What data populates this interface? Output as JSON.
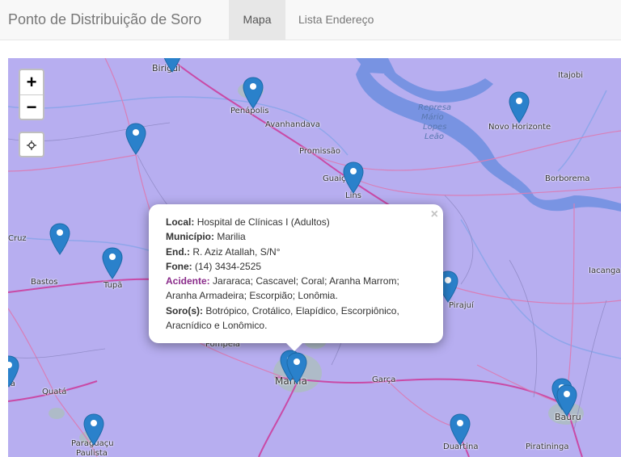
{
  "navbar": {
    "brand": "Ponto de Distribuição de Soro",
    "tabs": [
      {
        "label": "Mapa",
        "active": true
      },
      {
        "label": "Lista Endereço",
        "active": false
      }
    ]
  },
  "map": {
    "zoom_in": "+",
    "zoom_out": "−",
    "locate_icon": "crosshair-icon",
    "places": [
      "Birigui",
      "Penápolis",
      "Avanhandava",
      "Promissão",
      "Represa",
      "Mário",
      "Lopes",
      "Leão",
      "Itajobi",
      "Novo Horizonte",
      "Borborema",
      "Guaiçara",
      "Lins",
      "Cruz",
      "Bastos",
      "Tupã",
      "Iacanga",
      "Pirajuí",
      "Pompéia",
      "Marília",
      "Garça",
      "Quatá",
      "Paraguaçu",
      "Paulista",
      "Duartina",
      "Piratininga",
      "Bauru",
      "ia"
    ],
    "marker_color": "#2a81cb",
    "background_color": "#b7aef0"
  },
  "popup": {
    "local_label": "Local:",
    "local_value": "Hospital de Clínicas I (Adultos)",
    "municipio_label": "Município:",
    "municipio_value": "Marilia",
    "end_label": "End.:",
    "end_value": "R. Aziz Atallah, S/N°",
    "fone_label": "Fone:",
    "fone_value": "(14) 3434-2525",
    "acidente_label": "Acidente:",
    "acidente_value_1": "Jararaca; Cascavel; Coral; Aranha Marrom;",
    "acidente_value_2": "Aranha Armadeira; Escorpião; Lonômia.",
    "soro_label": "Soro(s):",
    "soro_value_1": "Botrópico, Crotálico, Elapídico, Escorpiônico,",
    "soro_value_2": "Aracnídico e Lonômico.",
    "close": "×"
  }
}
